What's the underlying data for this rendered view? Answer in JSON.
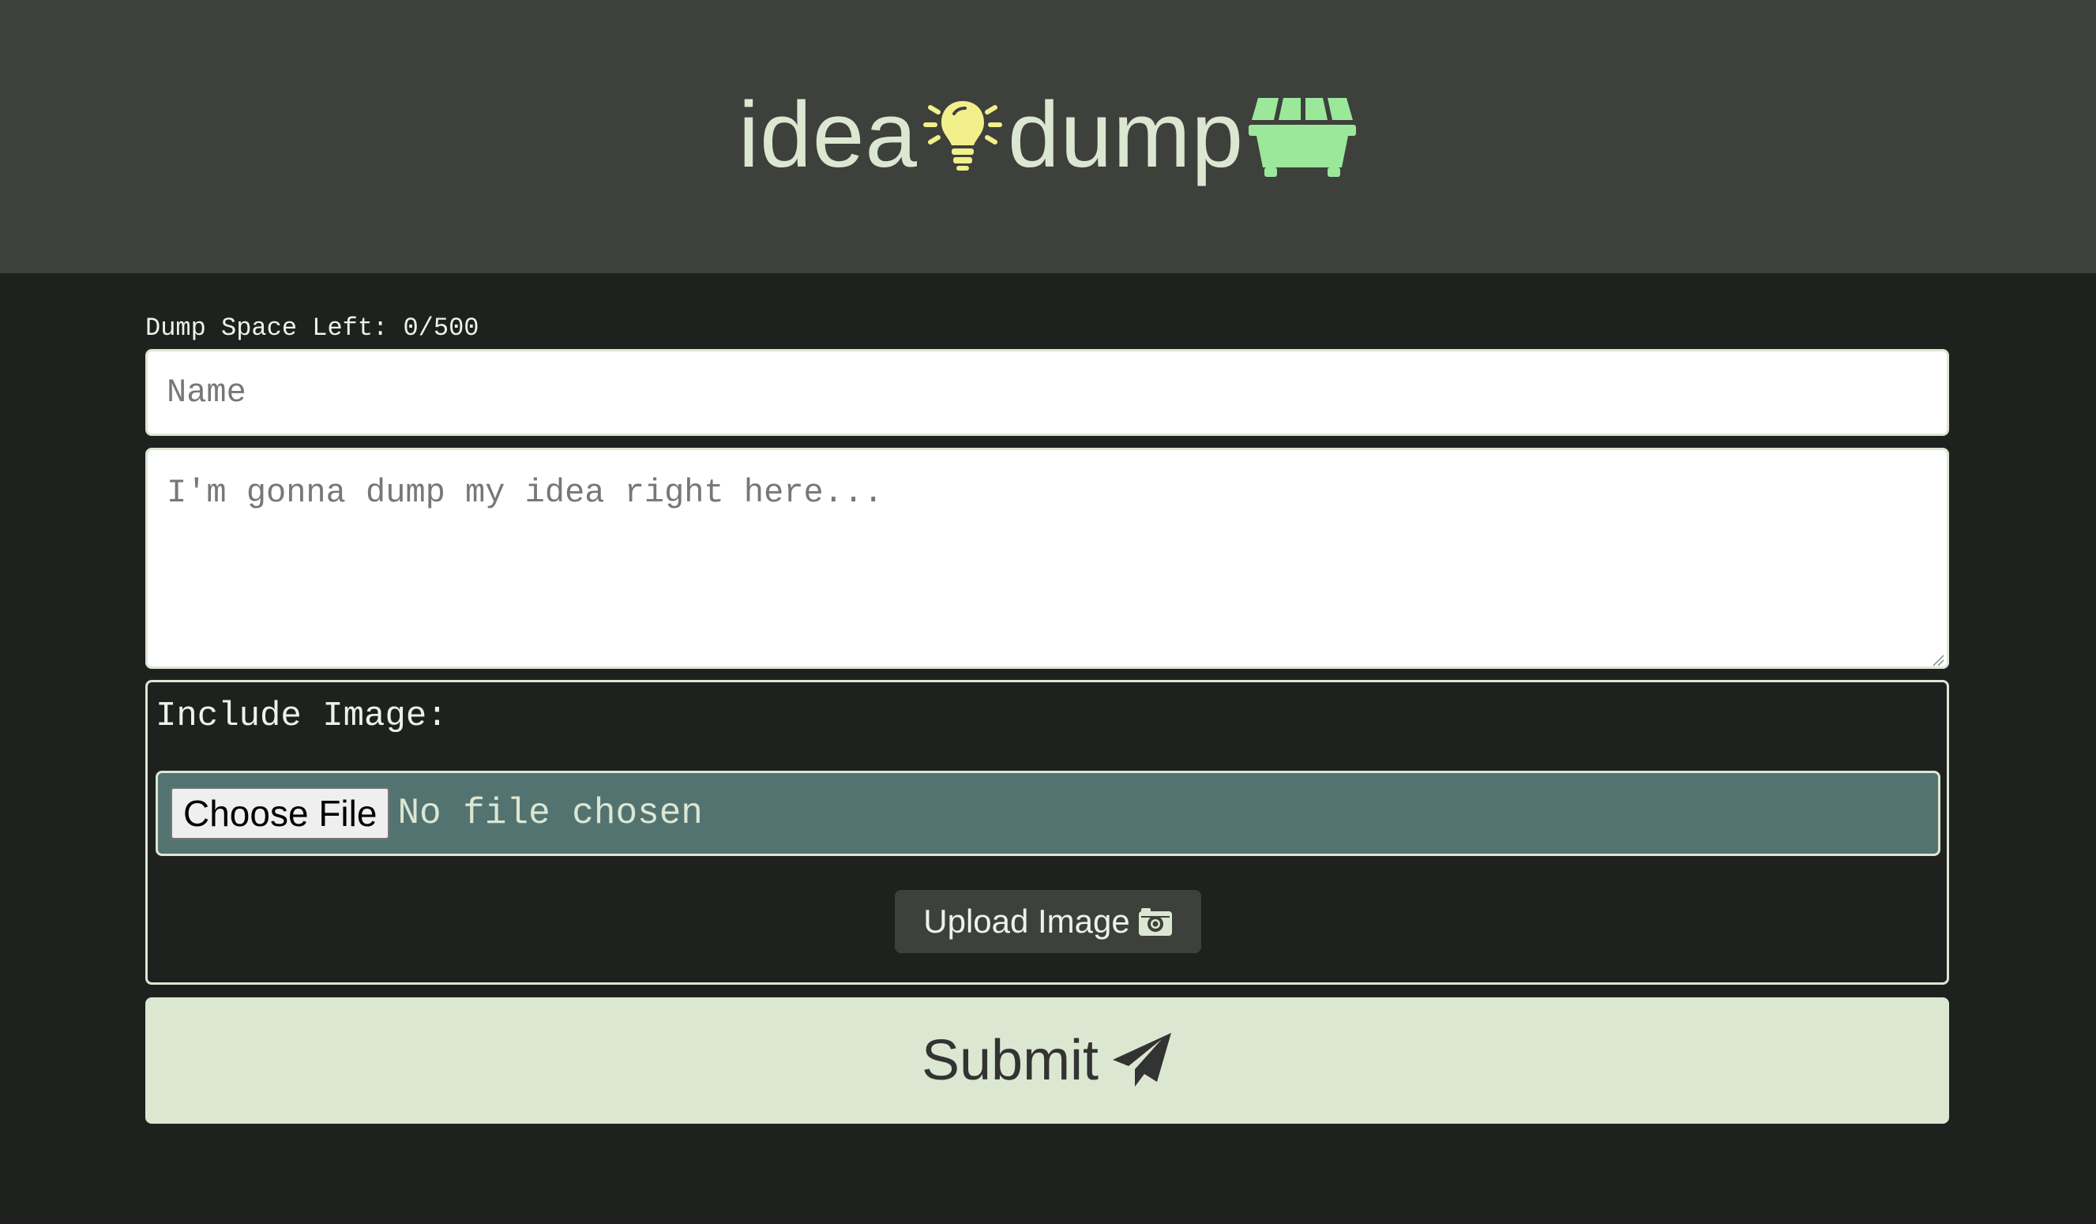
{
  "header": {
    "logo_word_1": "idea",
    "logo_word_2": "dump",
    "logo_icons": [
      "lightbulb-icon",
      "dumpster-icon"
    ],
    "colors": {
      "bulb": "#f1f08a",
      "dumpster": "#9be89b",
      "header_bg": "#3e403c",
      "page_bg": "#1f211f"
    }
  },
  "form": {
    "space_left_label": "Dump Space Left: 0/500",
    "name_placeholder": "Name",
    "idea_placeholder": "I'm gonna dump my idea right here...",
    "include_image_label": "Include Image:",
    "choose_file_label": "Choose File",
    "file_status": "No file chosen",
    "upload_label": "Upload Image",
    "upload_icon": "camera-icon",
    "submit_label": "Submit",
    "submit_icon": "paper-plane-icon",
    "colors": {
      "file_row_bg": "#537371",
      "submit_bg": "#dce7d2"
    }
  }
}
